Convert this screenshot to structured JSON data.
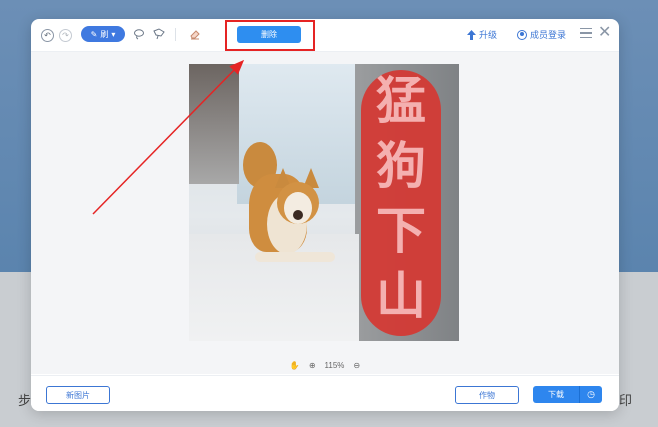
{
  "background": {
    "left_text": "步",
    "right_text": "印"
  },
  "toolbar": {
    "undo_label": "↶",
    "redo_label": "↷",
    "brush_label": "刷",
    "brush_caret": "▾",
    "delete_label": "删除",
    "upgrade_label": "升级",
    "login_label": "成员登录"
  },
  "image": {
    "slogan": [
      "猛",
      "狗",
      "下",
      "山"
    ]
  },
  "status": {
    "zoom": "115%"
  },
  "footer": {
    "new_image_label": "新图片",
    "work_label": "作物",
    "download_label": "下载"
  },
  "colors": {
    "accent": "#2e8ef0",
    "highlight": "#e52424"
  }
}
